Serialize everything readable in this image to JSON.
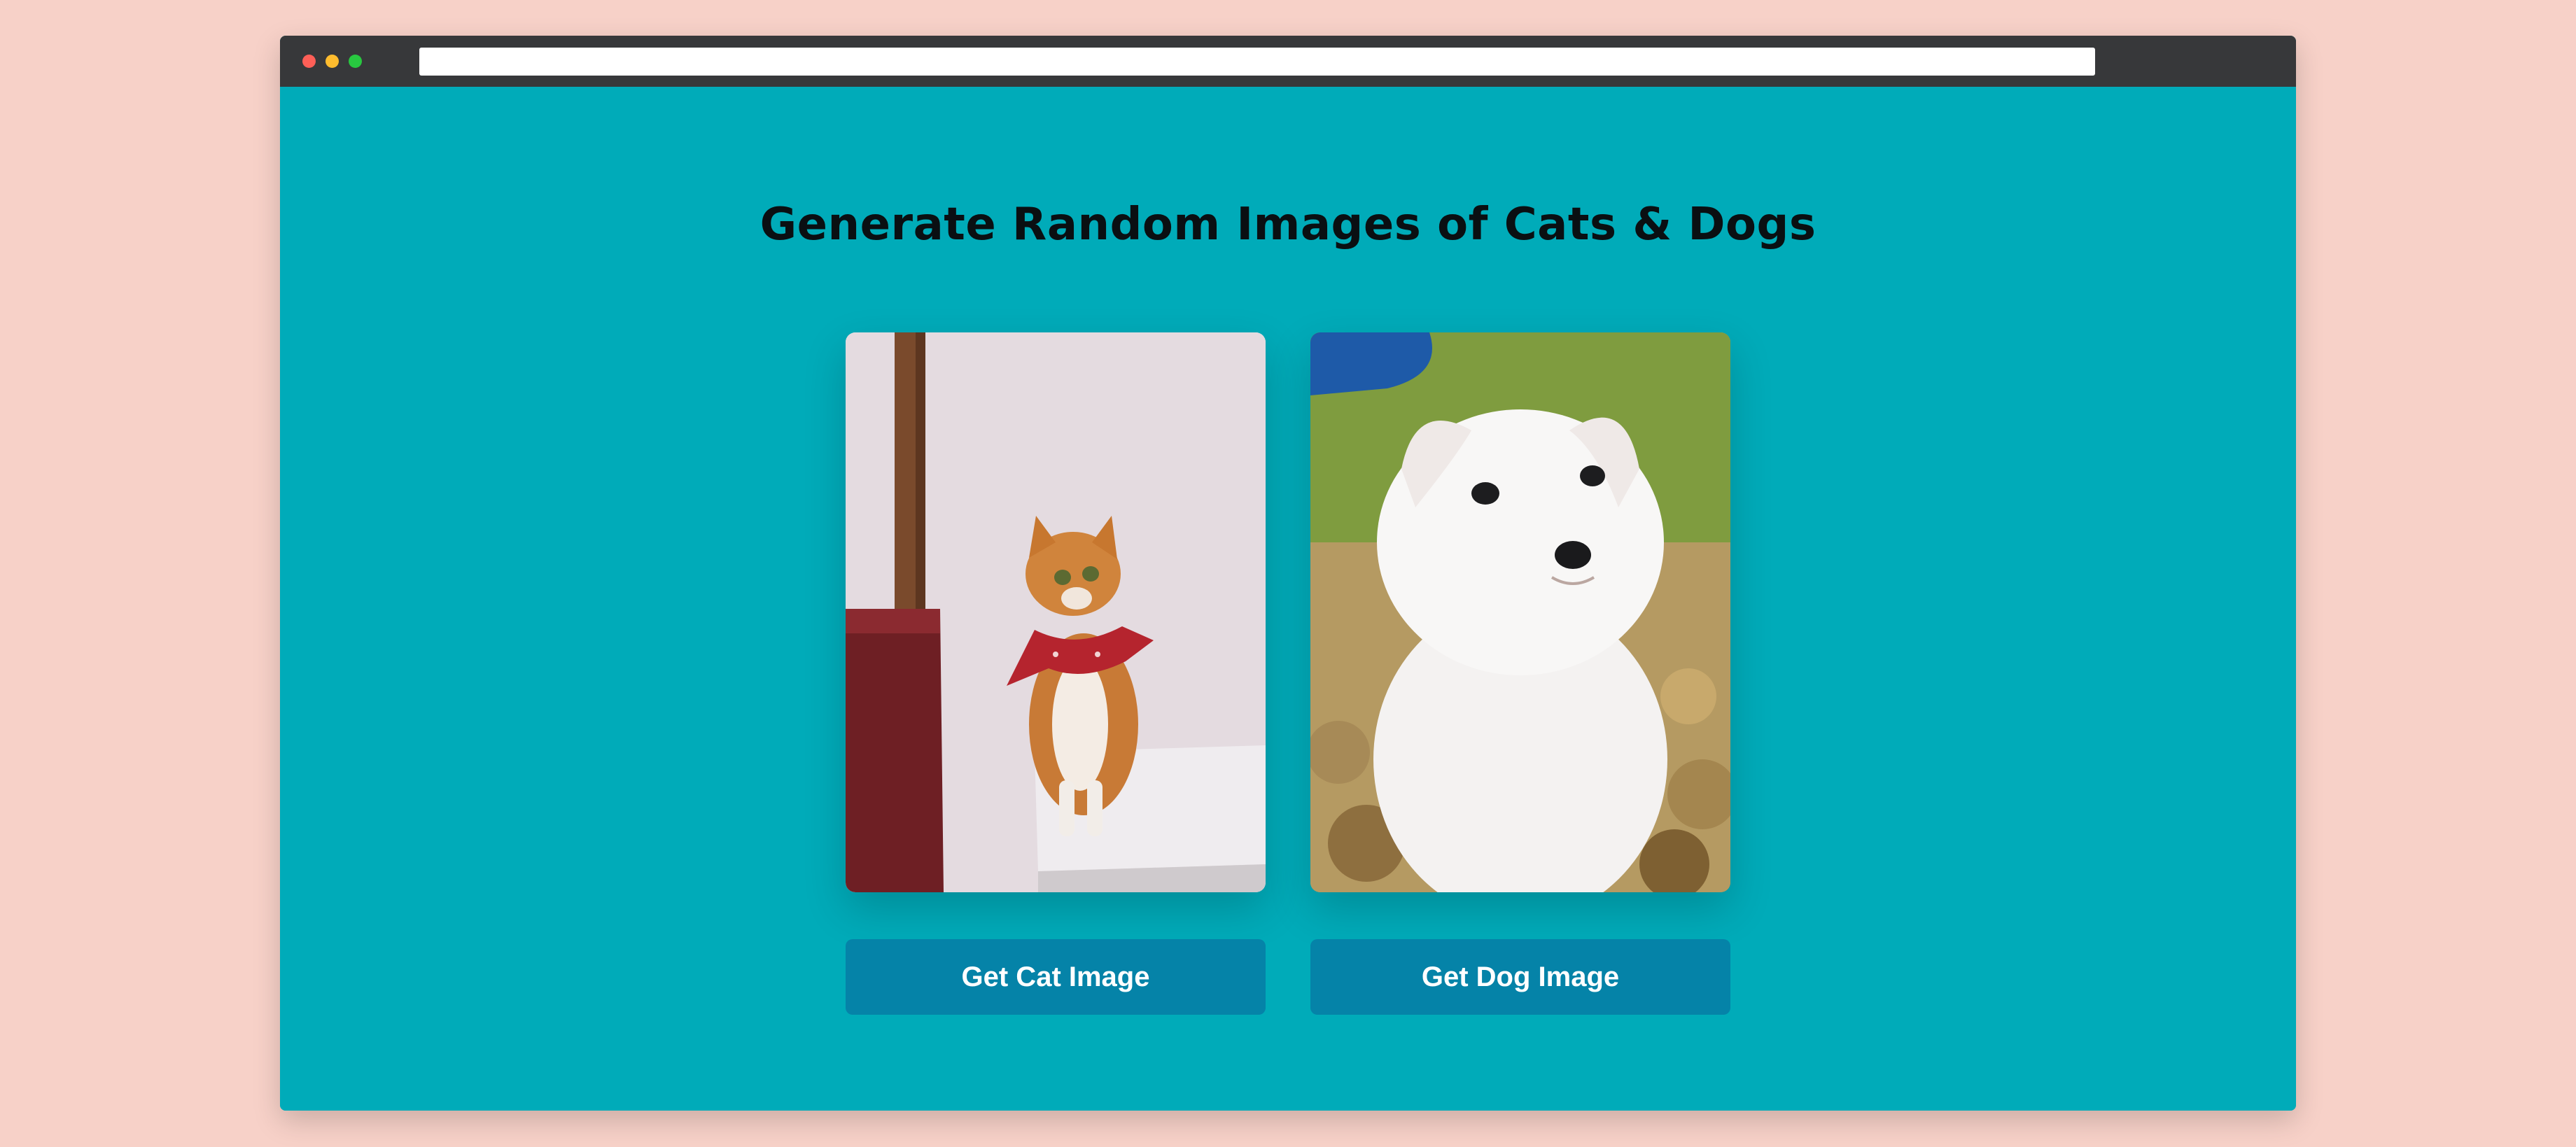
{
  "window": {
    "controls": [
      "close-dot",
      "minimize-dot",
      "maximize-dot"
    ],
    "url": ""
  },
  "page": {
    "title": "Generate Random Images of Cats & Dogs"
  },
  "cards": [
    {
      "subject": "cat",
      "image_desc_icon": "cat-photo",
      "button_label": "Get Cat Image"
    },
    {
      "subject": "dog",
      "image_desc_icon": "dog-photo",
      "button_label": "Get Dog Image"
    }
  ],
  "colors": {
    "background": "#f7d1c8",
    "page": "#00abb9",
    "button": "#0583a8",
    "titlebar": "#37383a"
  }
}
